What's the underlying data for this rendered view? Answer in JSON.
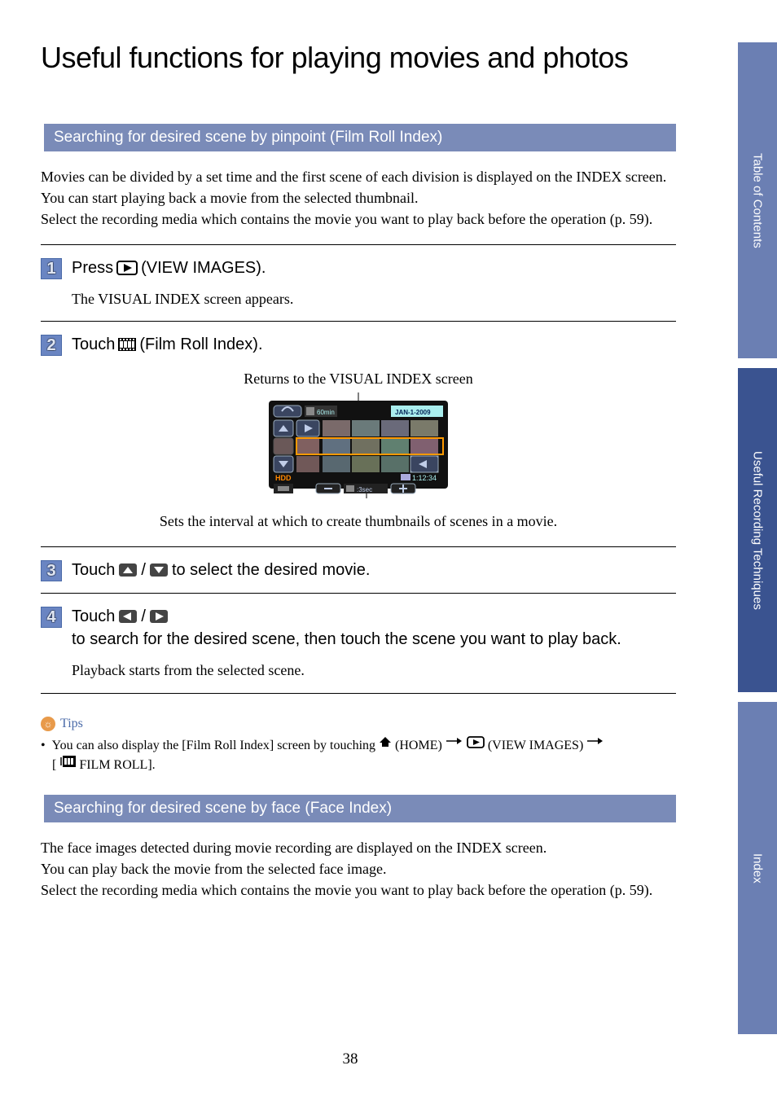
{
  "title": "Useful functions for playing movies and photos",
  "section1": {
    "heading": "Searching for desired scene by pinpoint (Film Roll Index)",
    "intro": "Movies can be divided by a set time and the first scene of each division is displayed on the INDEX screen. You can start playing back a movie from the selected thumbnail.\nSelect the recording media which contains the movie you want to play back before the operation (p. 59).",
    "steps": {
      "s1": {
        "num": "1",
        "title_a": "Press ",
        "title_b": " (VIEW IMAGES).",
        "body": "The VISUAL INDEX screen appears."
      },
      "s2": {
        "num": "2",
        "title_a": "Touch ",
        "title_b": " (Film Roll Index).",
        "caption_top": "Returns to the VISUAL INDEX screen",
        "caption_bottom": "Sets the interval at which to create thumbnails of scenes in a movie.",
        "screen": {
          "batt": "60min",
          "date": "JAN-1-2009",
          "media": "HDD",
          "time": "1:12:34",
          "interval": ":3sec"
        }
      },
      "s3": {
        "num": "3",
        "title_a": "Touch ",
        "title_b": "/",
        "title_c": " to select the desired movie."
      },
      "s4": {
        "num": "4",
        "title_a": "Touch ",
        "title_b": "/",
        "title_c": " to search for the desired scene, then touch the scene you want to play back.",
        "body": "Playback starts from the selected scene."
      }
    },
    "tips": {
      "label": "Tips",
      "bullet": "•",
      "a": "You can also display the [Film Roll Index] screen by touching ",
      "b": " (HOME) ",
      "c": " (VIEW IMAGES) ",
      "d": "[",
      "e": "FILM ROLL]."
    }
  },
  "section2": {
    "heading": "Searching for desired scene by face (Face Index)",
    "intro": "The face images detected during movie recording are displayed on the INDEX screen.\nYou can play back the movie from the selected face image.\nSelect the recording media which contains the movie you want to play back before the operation (p. 59)."
  },
  "tabs": {
    "t1": "Table of Contents",
    "t2": "Useful Recording Techniques",
    "t3": "Index"
  },
  "page_number": "38"
}
